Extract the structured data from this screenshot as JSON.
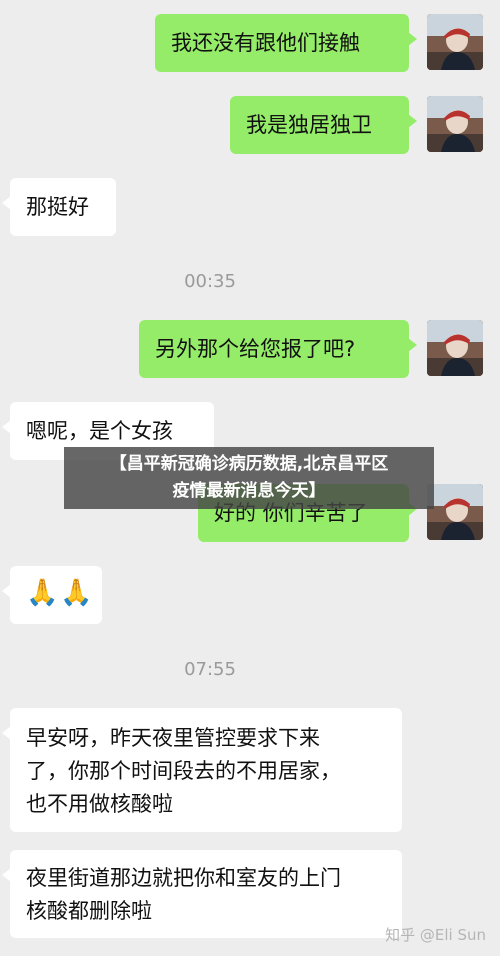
{
  "messages": [
    {
      "side": "me",
      "text": "我还没有跟他们接触"
    },
    {
      "side": "me",
      "text": "我是独居独卫"
    },
    {
      "side": "them",
      "text": "那挺好"
    },
    {
      "side": "time",
      "text": "00:35"
    },
    {
      "side": "me",
      "text": "另外那个给您报了吧?"
    },
    {
      "side": "them",
      "text": "嗯呢，是个女孩"
    },
    {
      "side": "me",
      "text": "好的 你们辛苦了"
    },
    {
      "side": "them",
      "text": "🙏🙏"
    },
    {
      "side": "time",
      "text": "07:55"
    },
    {
      "side": "them",
      "lines": [
        "早安呀，昨天夜里管控要求下来",
        "了，你那个时间段去的不用居家，",
        "也不用做核酸啦"
      ]
    },
    {
      "side": "them",
      "lines": [
        "夜里街道那边就把你和室友的上门",
        "核酸都删除啦"
      ]
    }
  ],
  "overlay": {
    "line1": "【昌平新冠确诊病历数据,北京昌平区",
    "line2": "疫情最新消息今天】"
  },
  "watermark": "知乎 @Eli Sun",
  "colors": {
    "my_bubble": "#95ec69",
    "their_bubble": "#ffffff",
    "background": "#ededed"
  }
}
